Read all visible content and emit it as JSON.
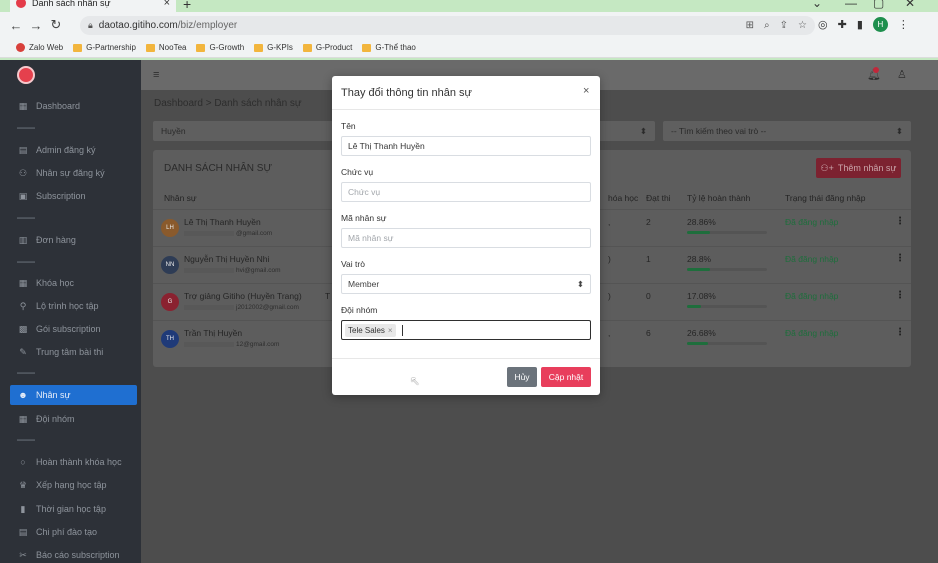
{
  "browser": {
    "tab_title": "Danh sách nhân sự",
    "tab_close": "×",
    "new_tab": "+",
    "url_host": "daotao.gitiho.com",
    "url_path": "/biz/employer",
    "profile_initial": "H",
    "bookmarks": [
      "Zalo Web",
      "G-Partnership",
      "NooTea",
      "G-Growth",
      "G-KPIs",
      "G-Product",
      "G-Thể thao"
    ]
  },
  "sidebar": {
    "items": [
      {
        "label": "Dashboard",
        "icon": "dashboard-icon",
        "glyph": "▦"
      },
      {
        "label": "Admin đăng ký",
        "icon": "list-icon",
        "glyph": "▤"
      },
      {
        "label": "Nhân sự đăng ký",
        "icon": "user-plus-icon",
        "glyph": "⚇"
      },
      {
        "label": "Subscription",
        "icon": "card-icon",
        "glyph": "▣"
      },
      {
        "label": "Đơn hàng",
        "icon": "order-icon",
        "glyph": "▥"
      },
      {
        "label": "Khóa học",
        "icon": "course-icon",
        "glyph": "▦"
      },
      {
        "label": "Lộ trình học tập",
        "icon": "route-icon",
        "glyph": "⚲"
      },
      {
        "label": "Gói subscription",
        "icon": "package-icon",
        "glyph": "▩"
      },
      {
        "label": "Trung tâm bài thi",
        "icon": "exam-icon",
        "glyph": "✎"
      },
      {
        "label": "Nhân sự",
        "icon": "users-icon",
        "glyph": "☻"
      },
      {
        "label": "Đội nhóm",
        "icon": "team-icon",
        "glyph": "▦"
      },
      {
        "label": "Hoàn thành khóa học",
        "icon": "circle-icon",
        "glyph": "○"
      },
      {
        "label": "Xếp hạng học tập",
        "icon": "trophy-icon",
        "glyph": "♛"
      },
      {
        "label": "Thời gian học tập",
        "icon": "chart-icon",
        "glyph": "▮"
      },
      {
        "label": "Chi phí đào tạo",
        "icon": "money-icon",
        "glyph": "▤"
      },
      {
        "label": "Báo cáo subscription",
        "icon": "report-icon",
        "glyph": "✂"
      }
    ],
    "active_label": "Nhân sự"
  },
  "main": {
    "breadcrumb": "Dashboard > Danh sách nhân sự",
    "filter_left": "Huyền",
    "filter_right": "-- Tìm kiếm theo vai trò --",
    "card_title": "DANH SÁCH NHÂN SỰ",
    "add_button": "Thêm nhân sự",
    "columns": {
      "employee": "Nhân sự",
      "courses": "hóa học",
      "passed": "Đạt thi",
      "completion": "Tỷ lệ hoàn thành",
      "login_status": "Trạng thái đăng nhập"
    },
    "rows": [
      {
        "initials": "LH",
        "name": "Lê Thị Thanh Huyền",
        "email": "@gmail.com",
        "passed": "2",
        "pct": "28.86%",
        "pct_value": 28.86,
        "status": "Đã đăng nhập",
        "avatar_color": "#8a5a2c"
      },
      {
        "initials": "NN",
        "name": "Nguyễn Thị Huyền Nhi",
        "email": "hvi@gmail.com",
        "passed": "1",
        "pct": "28.8%",
        "pct_value": 28.8,
        "status": "Đã đăng nhập",
        "avatar_color": "#2e3c55"
      },
      {
        "initials": "G",
        "name": "Trợ giảng Gitiho (Huyền Trang)",
        "email": "j2012002@gmail.com",
        "passed": "0",
        "pct": "17.08%",
        "pct_value": 17.08,
        "status": "Đã đăng nhập",
        "avatar_color": "#8a2230"
      },
      {
        "initials": "TH",
        "name": "Trần Thị Huyền",
        "email": "12@gmail.com",
        "passed": "6",
        "pct": "26.68%",
        "pct_value": 26.68,
        "status": "Đã đăng nhập",
        "avatar_color": "#1f3a78"
      }
    ]
  },
  "modal": {
    "title": "Thay đổi thông tin nhân sự",
    "close": "×",
    "name_label": "Tên",
    "name_value": "Lê Thị Thanh Huyền",
    "position_label": "Chức vụ",
    "position_placeholder": "Chức vụ",
    "code_label": "Mã nhân sự",
    "code_placeholder": "Mã nhân sự",
    "role_label": "Vai trò",
    "role_value": "Member",
    "team_label": "Đội nhóm",
    "team_tag": "Tele Sales",
    "cancel_button": "Hủy",
    "update_button": "Cập nhật"
  }
}
